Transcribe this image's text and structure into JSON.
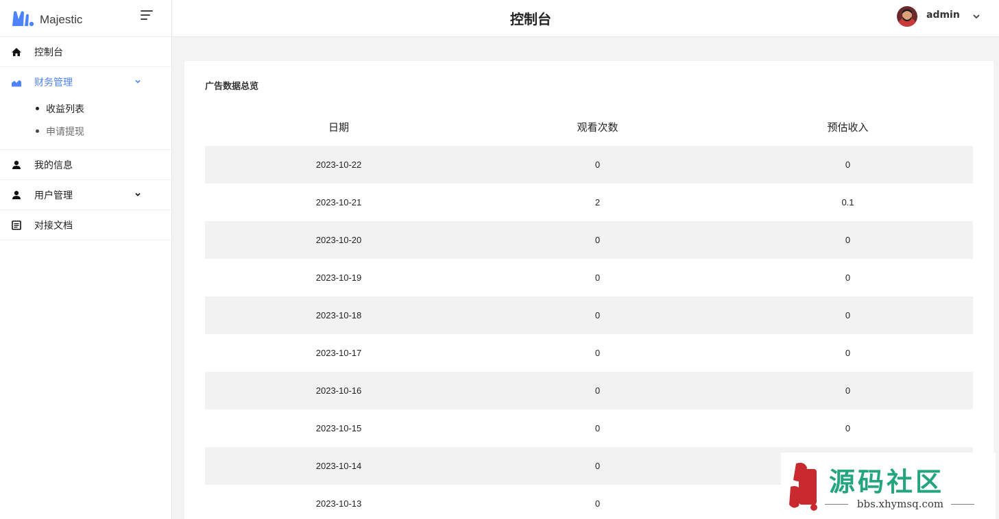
{
  "brand": {
    "name": "Majestic",
    "accent": "#4d83ff"
  },
  "sidebar": {
    "items": [
      {
        "label": "控制台",
        "icon": "home-icon"
      },
      {
        "label": "财务管理",
        "icon": "chart-icon",
        "expanded": true,
        "children": [
          {
            "label": "收益列表"
          },
          {
            "label": "申请提现"
          }
        ]
      },
      {
        "label": "我的信息",
        "icon": "user-icon"
      },
      {
        "label": "用户管理",
        "icon": "user-icon"
      },
      {
        "label": "对接文档",
        "icon": "document-icon"
      }
    ]
  },
  "header": {
    "title": "控制台",
    "user": "admin"
  },
  "card": {
    "title": "广告数据总览",
    "columns": [
      "日期",
      "观看次数",
      "预估收入"
    ],
    "rows": [
      [
        "2023-10-22",
        "0",
        "0"
      ],
      [
        "2023-10-21",
        "2",
        "0.1"
      ],
      [
        "2023-10-20",
        "0",
        "0"
      ],
      [
        "2023-10-19",
        "0",
        "0"
      ],
      [
        "2023-10-18",
        "0",
        "0"
      ],
      [
        "2023-10-17",
        "0",
        "0"
      ],
      [
        "2023-10-16",
        "0",
        "0"
      ],
      [
        "2023-10-15",
        "0",
        "0"
      ],
      [
        "2023-10-14",
        "0",
        ""
      ],
      [
        "2023-10-13",
        "0",
        ""
      ]
    ]
  },
  "watermark": {
    "title": "源码社区",
    "url": "bbs.xhymsq.com",
    "color": "#1ea37a"
  }
}
